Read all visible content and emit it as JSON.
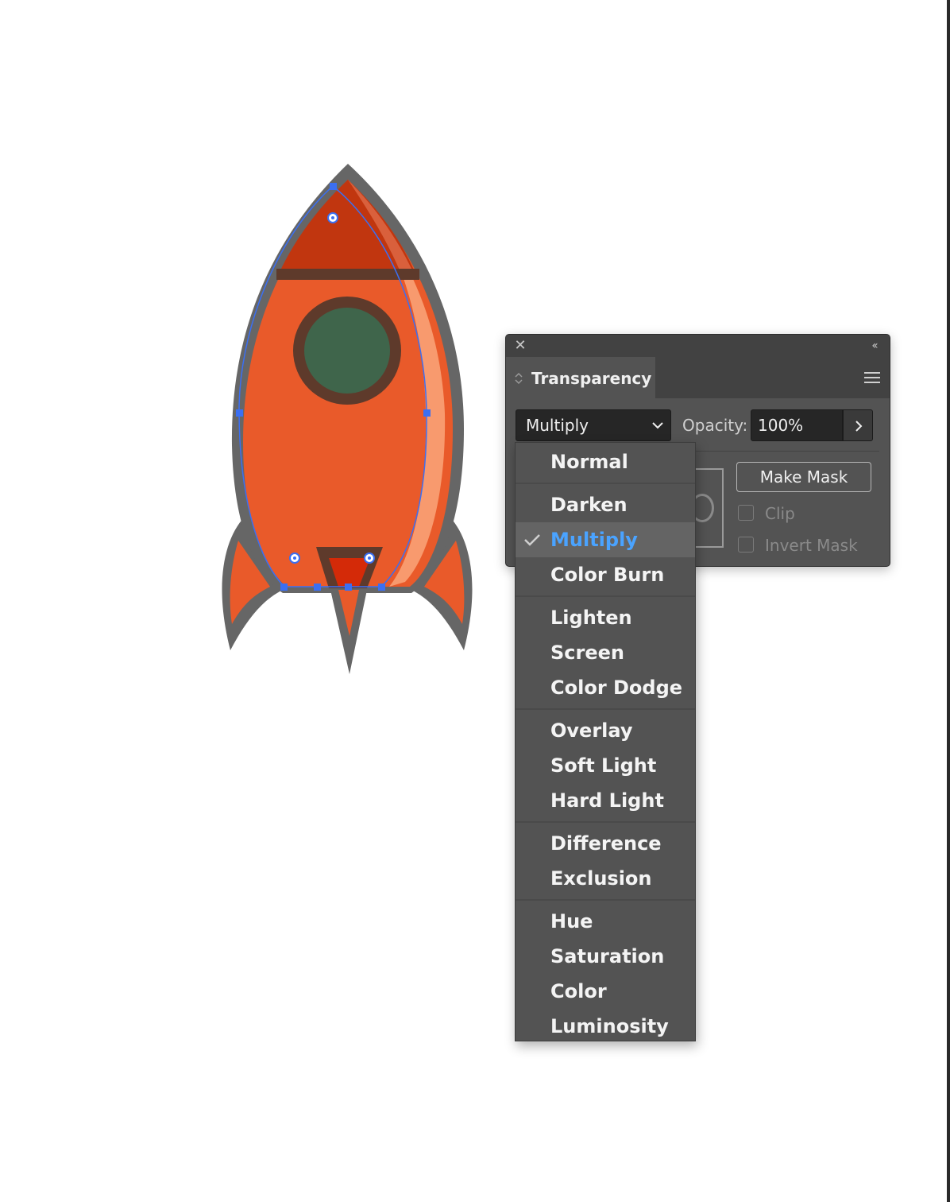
{
  "panel": {
    "title": "Transparency",
    "blend_mode": "Multiply",
    "opacity_label": "Opacity:",
    "opacity_value": "100%",
    "make_mask_label": "Make Mask",
    "clip_label": "Clip",
    "invert_mask_label": "Invert Mask"
  },
  "dropdown": {
    "selected": "Multiply",
    "groups": [
      [
        "Normal"
      ],
      [
        "Darken",
        "Multiply",
        "Color Burn"
      ],
      [
        "Lighten",
        "Screen",
        "Color Dodge"
      ],
      [
        "Overlay",
        "Soft Light",
        "Hard Light"
      ],
      [
        "Difference",
        "Exclusion"
      ],
      [
        "Hue",
        "Saturation",
        "Color",
        "Luminosity"
      ]
    ]
  },
  "colors": {
    "selection_accent": "#4aa3ff",
    "rocket_body": "#e95a2a",
    "rocket_nose": "#c1360f",
    "rocket_highlight": "#f89a6e",
    "rocket_outline": "#666666",
    "window_green": "#3f654b",
    "window_ring": "#5e3a2b",
    "anchor_blue": "#3b6ff2"
  }
}
